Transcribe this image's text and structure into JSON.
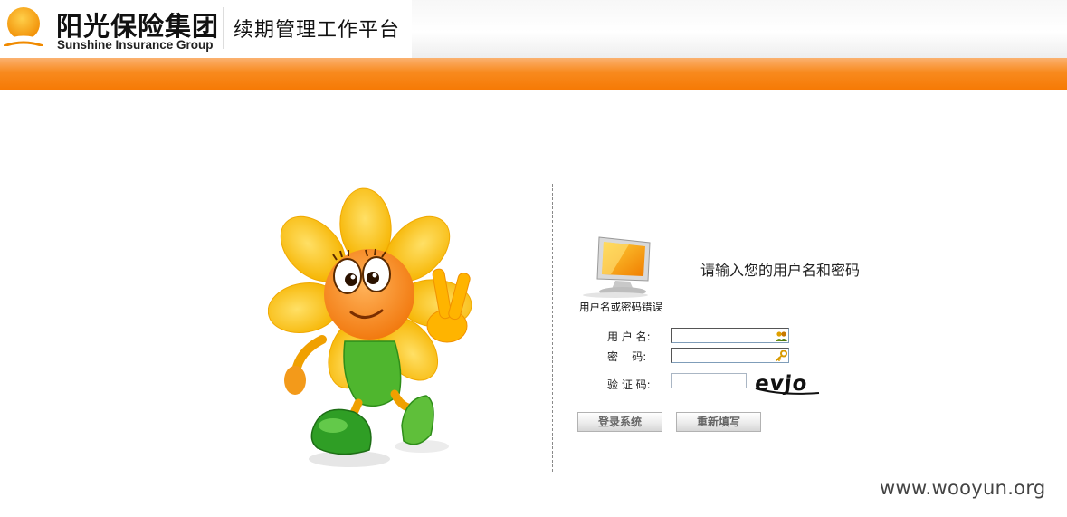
{
  "header": {
    "company_cn": "阳光保险集团",
    "company_en": "Sunshine Insurance Group",
    "platform_title": "续期管理工作平台",
    "brand_orange": "#f7810e"
  },
  "login": {
    "error_message": "用户名或密码错误",
    "prompt": "请输入您的用户名和密码",
    "username_label": "用 户 名:",
    "password_label": "密    码:",
    "captcha_label": "验 证 码:",
    "username_value": "",
    "password_value": "",
    "captcha_value": "",
    "captcha_text": "evjo",
    "username_icon": "users-icon",
    "password_icon": "key-icon",
    "login_button": "登录系统",
    "reset_button": "重新填写"
  },
  "watermark": "www.wooyun.org"
}
